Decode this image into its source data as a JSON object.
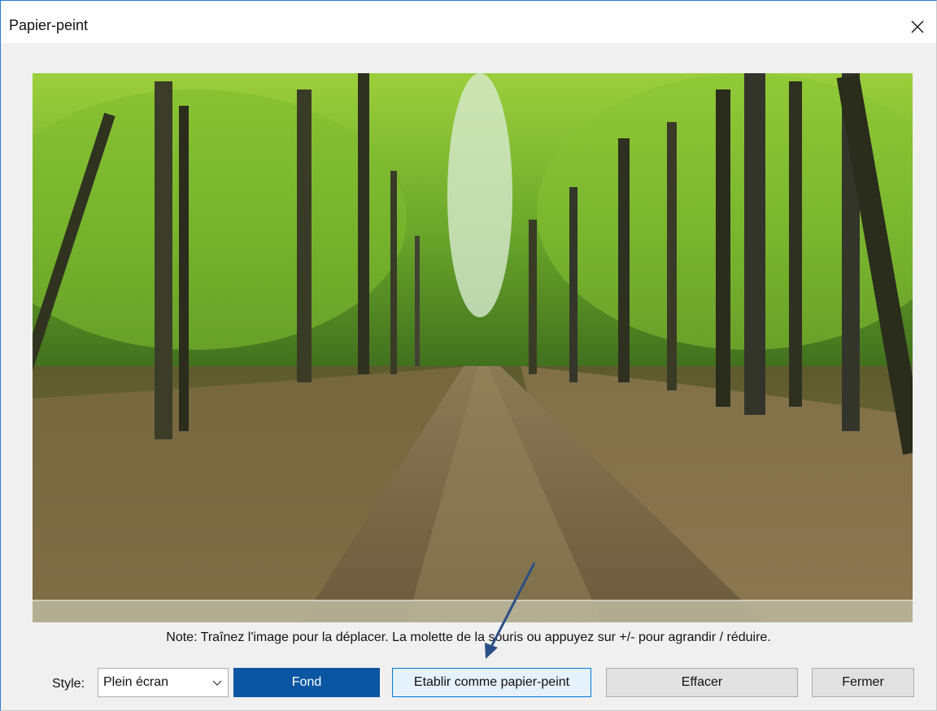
{
  "window": {
    "title": "Papier-peint",
    "close_label": "Fermer la fenêtre"
  },
  "preview": {
    "description": "Aperçu du papier-peint"
  },
  "note": "Note: Traînez l'image pour la déplacer. La molette de la souris ou appuyez sur +/- pour agrandir / réduire.",
  "controls": {
    "style_label": "Style:",
    "style_value": "Plein écran",
    "fond_label": "Fond",
    "etablir_label": "Etablir comme papier-peint",
    "effacer_label": "Effacer",
    "fermer_label": "Fermer"
  },
  "colors": {
    "accent_button": "#0b56a3",
    "annotation_arrow": "#2a4f86"
  }
}
